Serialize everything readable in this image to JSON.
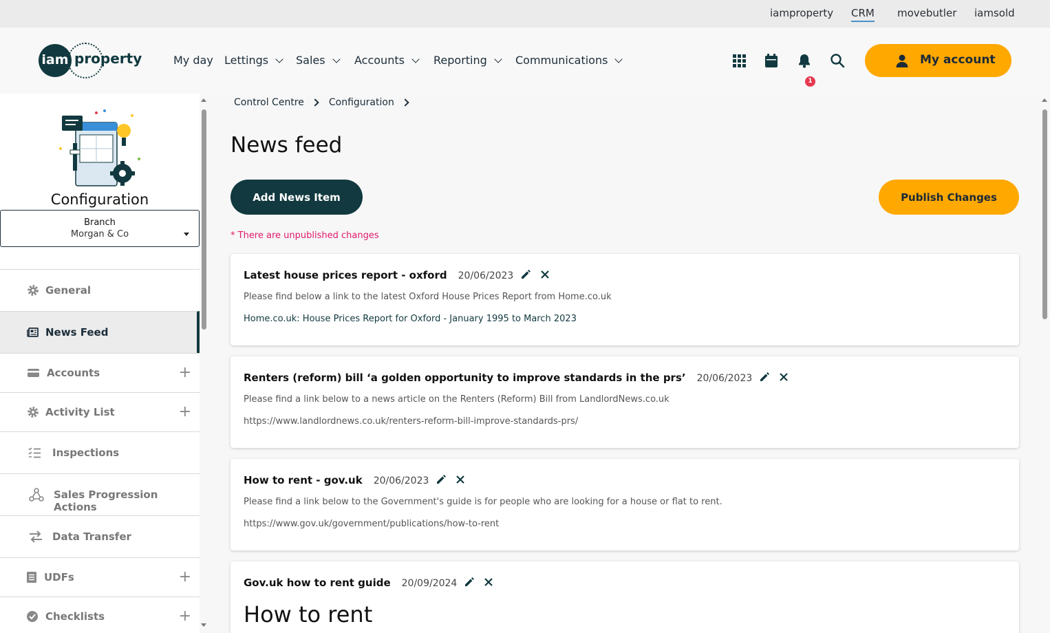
{
  "top_links": [
    {
      "label": "iamproperty"
    },
    {
      "label": "CRM"
    },
    {
      "label": "movebutler"
    },
    {
      "label": "iamsold"
    }
  ],
  "logo": {
    "circle": "iam",
    "word": "property"
  },
  "nav": [
    {
      "label": "My day"
    },
    {
      "label": "Lettings"
    },
    {
      "label": "Sales"
    },
    {
      "label": "Accounts"
    },
    {
      "label": "Reporting"
    },
    {
      "label": "Communications"
    }
  ],
  "header": {
    "notification_count": "1",
    "my_account_label": "My account"
  },
  "sidebar": {
    "title": "Configuration",
    "branch_label": "Branch",
    "branch_value": "Morgan & Co",
    "items": [
      {
        "label": "General",
        "icon": "gear-icon"
      },
      {
        "label": "News Feed",
        "icon": "newspaper-icon"
      },
      {
        "label": "Accounts",
        "icon": "credit-card-icon"
      },
      {
        "label": "Activity List",
        "icon": "gear-icon"
      },
      {
        "label": "Inspections",
        "icon": "checklist-icon"
      },
      {
        "label": "Sales Progression Actions",
        "icon": "webhook-icon"
      },
      {
        "label": "Data Transfer",
        "icon": "transfer-arrows-icon"
      },
      {
        "label": "UDFs",
        "icon": "list-icon"
      },
      {
        "label": "Checklists",
        "icon": "check-circle-icon"
      }
    ]
  },
  "breadcrumb": [
    "Control Centre",
    "Configuration"
  ],
  "page_title": "News feed",
  "buttons": {
    "add": "Add News Item",
    "publish": "Publish Changes"
  },
  "warning": "* There are unpublished changes",
  "news_items": [
    {
      "title": "Latest house prices report - oxford",
      "date": "20/06/2023",
      "description": "Please find below a link to the latest Oxford House Prices Report from Home.co.uk",
      "link": "Home.co.uk: House Prices Report for Oxford - January 1995 to March 2023"
    },
    {
      "title": "Renters (reform) bill ‘a golden opportunity to improve standards in the prs’",
      "date": "20/06/2023",
      "description": "Please find a link below to a news article on the Renters (Reform) Bill from LandlordNews.co.uk",
      "link": "https://www.landlordnews.co.uk/renters-reform-bill-improve-standards-prs/"
    },
    {
      "title": "How to rent - gov.uk",
      "date": "20/06/2023",
      "description": "Please find a link below to the Government's guide is for people who are looking for a house or flat to rent.",
      "link": "https://www.gov.uk/government/publications/how-to-rent"
    },
    {
      "title": "Gov.uk how to rent guide",
      "date": "20/09/2024",
      "heading": "How to rent"
    }
  ],
  "colors": {
    "brand_dark": "#11393f",
    "accent_orange": "#ffa800",
    "warning_pink": "#e0196b",
    "badge_red": "#e53950"
  }
}
